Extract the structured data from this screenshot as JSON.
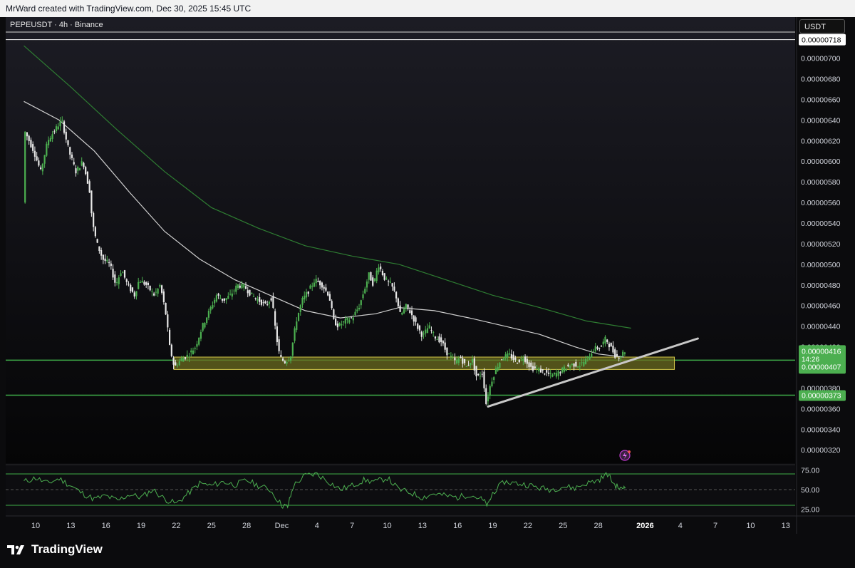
{
  "header": {
    "credit": "MrWard created with TradingView.com, Dec 30, 2025 15:45 UTC"
  },
  "symbol_label": "PEPEUSDT · 4h · Binance",
  "currency_label": "USDT",
  "brand": {
    "name": "TradingView",
    "logo": "tradingview-logo"
  },
  "colors": {
    "bull": "#26a69a",
    "bull_green": "#4caf50",
    "bear": "#e8e8e8",
    "ma_green": "#2e7d32",
    "ma_white": "#d0d0d0",
    "zone_fill": "#6b6b1f",
    "zone_border": "#d4c84a",
    "level_green": "#3fae49",
    "trendline": "#c8c8c8",
    "label_green": "#4caf50"
  },
  "chart_data": {
    "type": "candlestick",
    "title": "PEPEUSDT · 4h · Binance",
    "y_axis": {
      "unit": "USDT",
      "ticks": [
        "0.00000700",
        "0.00000680",
        "0.00000660",
        "0.00000640",
        "0.00000620",
        "0.00000600",
        "0.00000580",
        "0.00000560",
        "0.00000540",
        "0.00000520",
        "0.00000500",
        "0.00000480",
        "0.00000460",
        "0.00000440",
        "0.00000420",
        "0.00000400",
        "0.00000380",
        "0.00000360",
        "0.00000340",
        "0.00000320"
      ],
      "range": [
        3.07e-06,
        7.26e-06
      ]
    },
    "x_axis": {
      "ticks": [
        {
          "label": "10",
          "day": 10
        },
        {
          "label": "13",
          "day": 13
        },
        {
          "label": "16",
          "day": 16
        },
        {
          "label": "19",
          "day": 19
        },
        {
          "label": "22",
          "day": 22
        },
        {
          "label": "25",
          "day": 25
        },
        {
          "label": "28",
          "day": 28
        },
        {
          "label": "Dec",
          "day": 31
        },
        {
          "label": "4",
          "day": 34
        },
        {
          "label": "7",
          "day": 37
        },
        {
          "label": "10",
          "day": 40
        },
        {
          "label": "13",
          "day": 43
        },
        {
          "label": "16",
          "day": 46
        },
        {
          "label": "19",
          "day": 49
        },
        {
          "label": "22",
          "day": 52
        },
        {
          "label": "25",
          "day": 55
        },
        {
          "label": "28",
          "day": 58
        },
        {
          "label": "2026",
          "day": 62,
          "bold": true
        },
        {
          "label": "4",
          "day": 65
        },
        {
          "label": "7",
          "day": 68
        },
        {
          "label": "10",
          "day": 71
        },
        {
          "label": "13",
          "day": 74
        }
      ]
    },
    "price_path": [
      [
        9.1,
        5.6e-06
      ],
      [
        9.2,
        6.3e-06
      ],
      [
        10.0,
        6.1e-06
      ],
      [
        10.6,
        5.9e-06
      ],
      [
        11.2,
        6.2e-06
      ],
      [
        11.8,
        6.3e-06
      ],
      [
        12.4,
        6.4e-06
      ],
      [
        13.0,
        6.1e-06
      ],
      [
        13.6,
        5.9e-06
      ],
      [
        14.2,
        6e-06
      ],
      [
        14.8,
        5.7e-06
      ],
      [
        15.0,
        5.4e-06
      ],
      [
        15.4,
        5.2e-06
      ],
      [
        15.9,
        5.05e-06
      ],
      [
        16.5,
        5e-06
      ],
      [
        17.0,
        4.8e-06
      ],
      [
        17.5,
        4.95e-06
      ],
      [
        18.0,
        4.8e-06
      ],
      [
        18.6,
        4.7e-06
      ],
      [
        19.0,
        4.85e-06
      ],
      [
        19.6,
        4.8e-06
      ],
      [
        20.3,
        4.7e-06
      ],
      [
        20.8,
        4.8e-06
      ],
      [
        21.3,
        4.5e-06
      ],
      [
        21.6,
        4.2e-06
      ],
      [
        22.0,
        4e-06
      ],
      [
        22.6,
        4.08e-06
      ],
      [
        23.2,
        4.12e-06
      ],
      [
        23.8,
        4.2e-06
      ],
      [
        24.4,
        4.4e-06
      ],
      [
        25.0,
        4.55e-06
      ],
      [
        25.6,
        4.7e-06
      ],
      [
        26.2,
        4.65e-06
      ],
      [
        26.8,
        4.7e-06
      ],
      [
        27.4,
        4.8e-06
      ],
      [
        28.0,
        4.78e-06
      ],
      [
        28.6,
        4.7e-06
      ],
      [
        29.2,
        4.65e-06
      ],
      [
        29.8,
        4.6e-06
      ],
      [
        30.3,
        4.68e-06
      ],
      [
        30.7,
        4.3e-06
      ],
      [
        31.0,
        4.1e-06
      ],
      [
        31.4,
        4.05e-06
      ],
      [
        31.9,
        4.1e-06
      ],
      [
        32.4,
        4.45e-06
      ],
      [
        32.9,
        4.65e-06
      ],
      [
        33.5,
        4.75e-06
      ],
      [
        34.0,
        4.85e-06
      ],
      [
        34.6,
        4.8e-06
      ],
      [
        35.2,
        4.7e-06
      ],
      [
        35.6,
        4.45e-06
      ],
      [
        36.0,
        4.4e-06
      ],
      [
        36.6,
        4.45e-06
      ],
      [
        37.2,
        4.48e-06
      ],
      [
        37.8,
        4.6e-06
      ],
      [
        38.2,
        4.75e-06
      ],
      [
        38.6,
        4.9e-06
      ],
      [
        39.0,
        4.8e-06
      ],
      [
        39.4,
        5e-06
      ],
      [
        40.0,
        4.85e-06
      ],
      [
        40.5,
        4.8e-06
      ],
      [
        40.9,
        4.7e-06
      ],
      [
        41.3,
        4.5e-06
      ],
      [
        41.8,
        4.6e-06
      ],
      [
        42.3,
        4.5e-06
      ],
      [
        42.7,
        4.4e-06
      ],
      [
        43.2,
        4.3e-06
      ],
      [
        43.7,
        4.4e-06
      ],
      [
        44.2,
        4.3e-06
      ],
      [
        44.8,
        4.25e-06
      ],
      [
        45.2,
        4.15e-06
      ],
      [
        45.6,
        4.1e-06
      ],
      [
        46.0,
        4.05e-06
      ],
      [
        46.4,
        4.1e-06
      ],
      [
        46.9,
        4e-06
      ],
      [
        47.4,
        4.08e-06
      ],
      [
        47.8,
        3.9e-06
      ],
      [
        48.3,
        3.95e-06
      ],
      [
        48.6,
        3.65e-06
      ],
      [
        49.0,
        3.85e-06
      ],
      [
        49.5,
        4e-06
      ],
      [
        50.0,
        4.1e-06
      ],
      [
        50.6,
        4.12e-06
      ],
      [
        51.2,
        4.05e-06
      ],
      [
        51.8,
        4.1e-06
      ],
      [
        52.4,
        4e-06
      ],
      [
        53.0,
        3.98e-06
      ],
      [
        53.6,
        3.95e-06
      ],
      [
        54.2,
        3.92e-06
      ],
      [
        54.8,
        3.95e-06
      ],
      [
        55.4,
        4e-06
      ],
      [
        56.0,
        4.03e-06
      ],
      [
        56.6,
        4.02e-06
      ],
      [
        57.2,
        4.08e-06
      ],
      [
        57.8,
        4.18e-06
      ],
      [
        58.4,
        4.2e-06
      ],
      [
        58.8,
        4.28e-06
      ],
      [
        59.2,
        4.2e-06
      ],
      [
        59.6,
        4.12e-06
      ],
      [
        60.0,
        4.1e-06
      ],
      [
        60.4,
        4.16e-06
      ]
    ],
    "moving_averages": [
      {
        "color_key": "ma_green",
        "points": [
          [
            9.0,
            7.12e-06
          ],
          [
            13.0,
            6.72e-06
          ],
          [
            17.0,
            6.3e-06
          ],
          [
            21.0,
            5.9e-06
          ],
          [
            25.0,
            5.55e-06
          ],
          [
            29.0,
            5.35e-06
          ],
          [
            33.0,
            5.18e-06
          ],
          [
            37.0,
            5.08e-06
          ],
          [
            41.0,
            5e-06
          ],
          [
            45.0,
            4.85e-06
          ],
          [
            49.0,
            4.7e-06
          ],
          [
            53.0,
            4.58e-06
          ],
          [
            57.0,
            4.45e-06
          ],
          [
            60.8,
            4.38e-06
          ]
        ]
      },
      {
        "color_key": "ma_white",
        "points": [
          [
            9.0,
            6.58e-06
          ],
          [
            12.0,
            6.4e-06
          ],
          [
            15.0,
            6.1e-06
          ],
          [
            18.0,
            5.7e-06
          ],
          [
            21.0,
            5.32e-06
          ],
          [
            24.0,
            5.05e-06
          ],
          [
            27.0,
            4.85e-06
          ],
          [
            30.0,
            4.7e-06
          ],
          [
            33.0,
            4.55e-06
          ],
          [
            36.0,
            4.48e-06
          ],
          [
            39.0,
            4.52e-06
          ],
          [
            41.0,
            4.58e-06
          ],
          [
            44.0,
            4.55e-06
          ],
          [
            47.0,
            4.48e-06
          ],
          [
            50.0,
            4.4e-06
          ],
          [
            53.0,
            4.32e-06
          ],
          [
            56.0,
            4.2e-06
          ],
          [
            58.0,
            4.13e-06
          ],
          [
            60.2,
            4.1e-06
          ]
        ]
      }
    ],
    "horizontal_lines": [
      {
        "price": 7.18e-06,
        "label": "0.00000718",
        "style": "white-double"
      },
      {
        "price": 4.07e-06,
        "label": "0.00000407",
        "style": "green"
      },
      {
        "price": 3.73e-06,
        "label": "0.00000373",
        "style": "green"
      }
    ],
    "zone": {
      "from_day": 21.8,
      "to_day": 64.5,
      "top": 4.1e-06,
      "bottom": 3.98e-06
    },
    "trendline": {
      "points": [
        [
          48.6,
          3.62e-06
        ],
        [
          66.5,
          4.28e-06
        ]
      ]
    },
    "last_price": {
      "price": 4.16e-06,
      "label": "0.00000416",
      "countdown": "14:26"
    },
    "rsi": {
      "ticks": [
        "75.00",
        "50.00",
        "25.00"
      ],
      "range": [
        20,
        80
      ],
      "bands": [
        70,
        50,
        30
      ],
      "values": [
        [
          9.0,
          60
        ],
        [
          10.0,
          65
        ],
        [
          11.0,
          58
        ],
        [
          12.0,
          64
        ],
        [
          13.0,
          55
        ],
        [
          14.0,
          45
        ],
        [
          15.0,
          38
        ],
        [
          16.0,
          42
        ],
        [
          17.0,
          36
        ],
        [
          18.0,
          44
        ],
        [
          19.0,
          40
        ],
        [
          20.0,
          50
        ],
        [
          21.0,
          38
        ],
        [
          22.0,
          32
        ],
        [
          23.0,
          45
        ],
        [
          24.0,
          58
        ],
        [
          25.0,
          55
        ],
        [
          26.0,
          60
        ],
        [
          27.0,
          56
        ],
        [
          28.0,
          62
        ],
        [
          29.0,
          55
        ],
        [
          30.0,
          50
        ],
        [
          31.0,
          30
        ],
        [
          31.5,
          28
        ],
        [
          32.0,
          55
        ],
        [
          33.0,
          68
        ],
        [
          34.0,
          70
        ],
        [
          35.0,
          60
        ],
        [
          36.0,
          50
        ],
        [
          37.0,
          55
        ],
        [
          38.0,
          62
        ],
        [
          39.0,
          60
        ],
        [
          40.0,
          65
        ],
        [
          41.0,
          50
        ],
        [
          42.0,
          46
        ],
        [
          43.0,
          40
        ],
        [
          44.0,
          45
        ],
        [
          45.0,
          42
        ],
        [
          46.0,
          40
        ],
        [
          47.0,
          44
        ],
        [
          48.0,
          38
        ],
        [
          48.6,
          30
        ],
        [
          49.0,
          46
        ],
        [
          50.0,
          60
        ],
        [
          51.0,
          58
        ],
        [
          52.0,
          56
        ],
        [
          53.0,
          52
        ],
        [
          54.0,
          50
        ],
        [
          55.0,
          54
        ],
        [
          56.0,
          52
        ],
        [
          57.0,
          58
        ],
        [
          58.0,
          62
        ],
        [
          58.8,
          70
        ],
        [
          59.4,
          56
        ],
        [
          60.0,
          50
        ],
        [
          60.4,
          58
        ]
      ]
    }
  }
}
